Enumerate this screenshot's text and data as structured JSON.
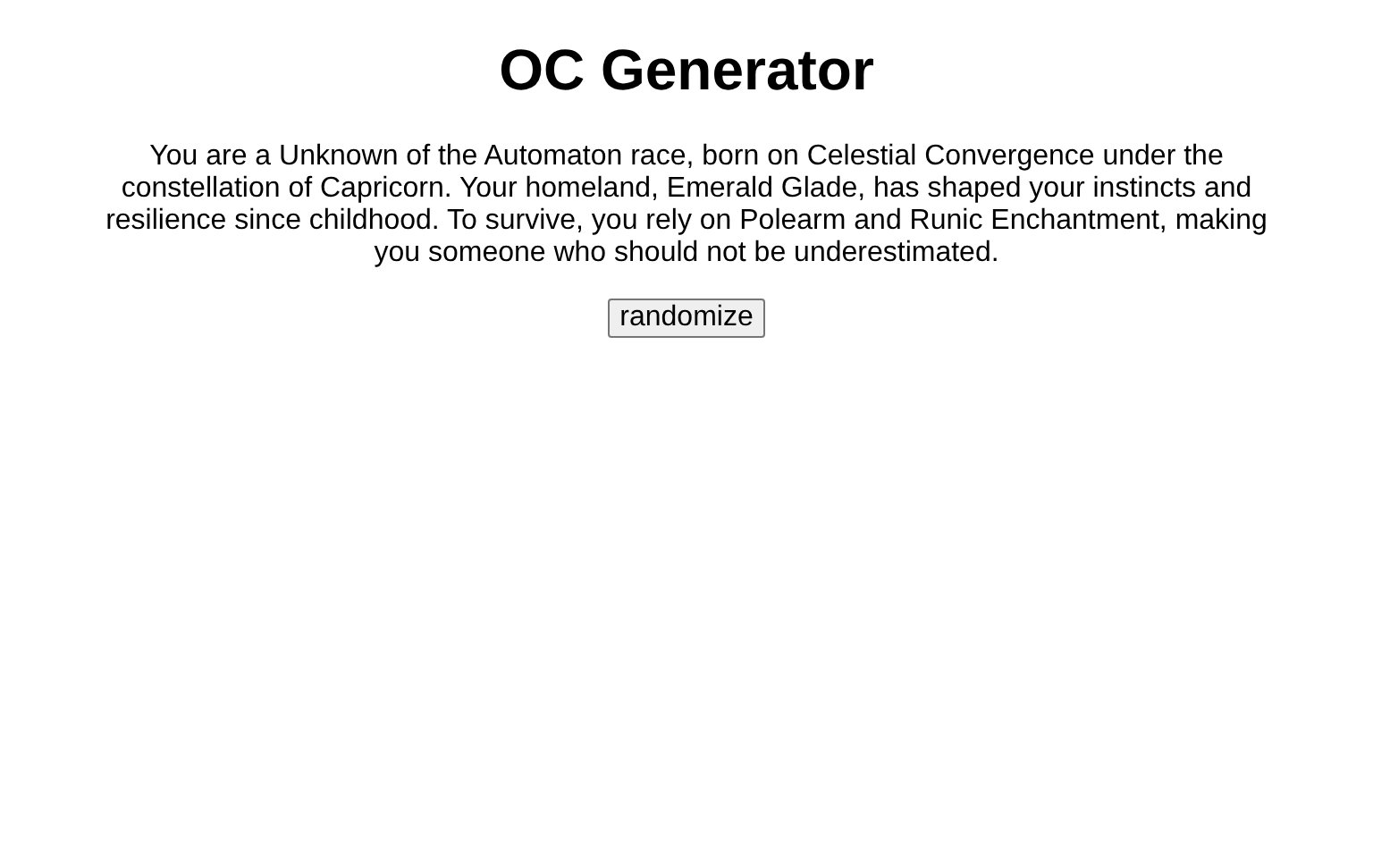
{
  "title": "OC Generator",
  "description": "You are a Unknown of the Automaton race, born on Celestial Convergence under the constellation of Capricorn. Your homeland, Emerald Glade, has shaped your instincts and resilience since childhood. To survive, you rely on Polearm and Runic Enchantment, making you someone who should not be underestimated.",
  "button": "randomize"
}
